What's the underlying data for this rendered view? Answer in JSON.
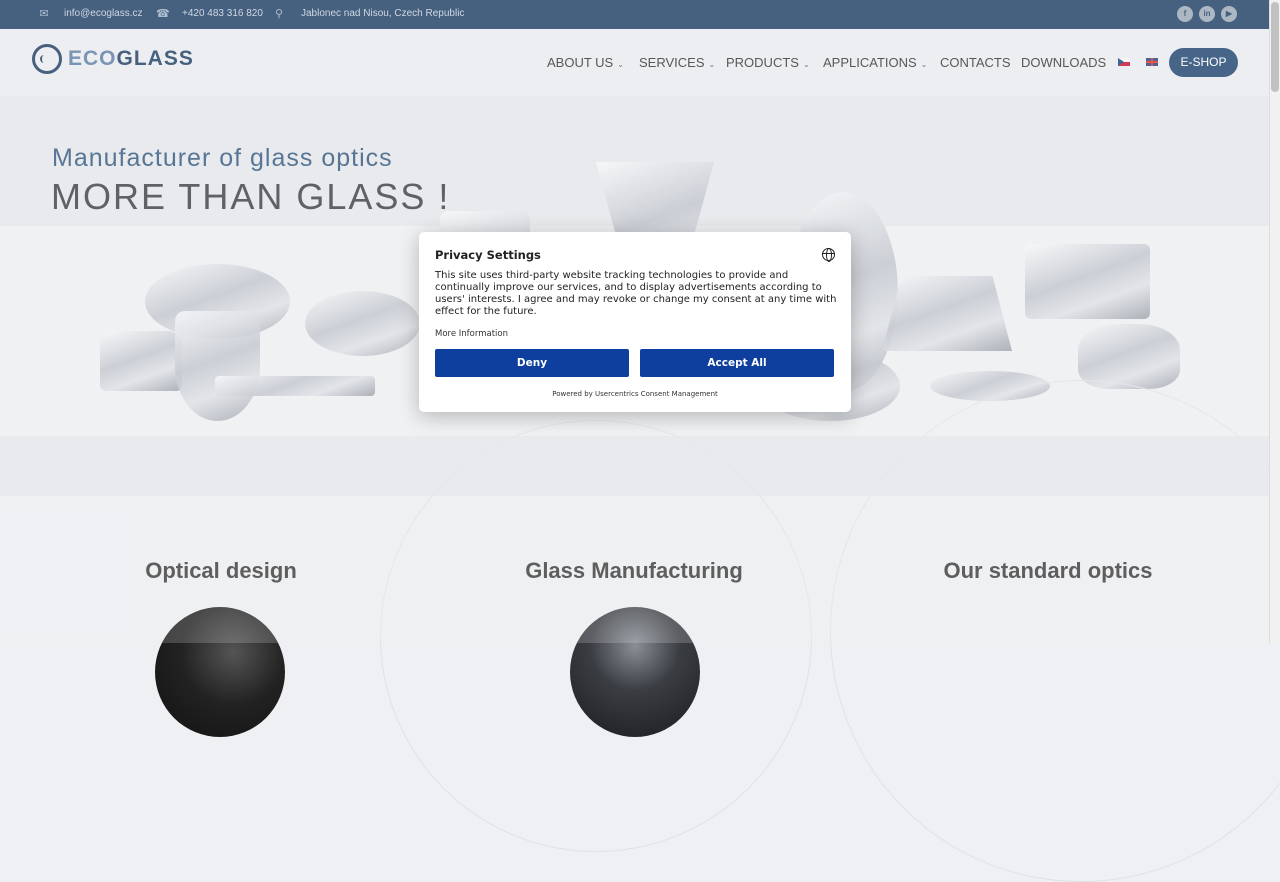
{
  "topbar": {
    "email": "info@ecoglass.cz",
    "phone": "+420 483 316 820",
    "address": "Jablonec nad Nisou, Czech Republic",
    "social": [
      "f",
      "in",
      "▶"
    ]
  },
  "header": {
    "logo_eco": "ECO",
    "logo_glass": "GLASS",
    "nav": [
      "ABOUT US",
      "SERVICES",
      "PRODUCTS",
      "APPLICATIONS",
      "CONTACTS",
      "DOWNLOADS"
    ],
    "eshop": "E-SHOP"
  },
  "hero": {
    "tagline": "Manufacturer of glass optics",
    "headline": "MORE THAN GLASS !"
  },
  "sections": [
    {
      "title": "Optical design"
    },
    {
      "title": "Glass Manufacturing"
    },
    {
      "title": "Our standard optics"
    }
  ],
  "consent": {
    "title": "Privacy Settings",
    "text": "This site uses third-party website tracking technologies to provide and continually improve our services, and to display advertisements according to users' interests. I agree and may revoke or change my consent at any time with effect for the future.",
    "more_info": "More Information",
    "deny": "Deny",
    "accept": "Accept All",
    "powered_by": "Powered by Usercentrics Consent Management"
  },
  "colors": {
    "topbar": "#1e3e63",
    "brand": "#1f3d62",
    "button": "#0e3f9e"
  }
}
